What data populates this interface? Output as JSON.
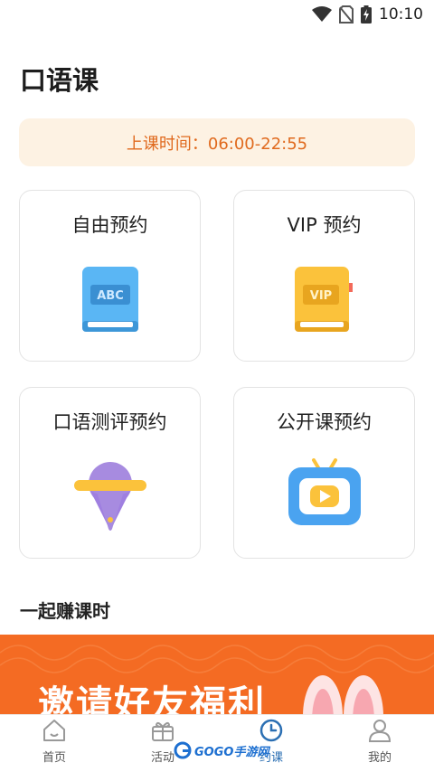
{
  "status_bar": {
    "time": "10:10"
  },
  "page": {
    "title": "口语课"
  },
  "schedule": {
    "text": "上课时间：06:00-22:55"
  },
  "cards": [
    {
      "label": "自由预约",
      "icon": "abc-book-icon"
    },
    {
      "label": "VIP 预约",
      "icon": "vip-book-icon"
    },
    {
      "label": "口语测评预约",
      "icon": "lollipop-microphone-icon"
    },
    {
      "label": "公开课预约",
      "icon": "tv-play-icon"
    }
  ],
  "icon_text": {
    "abc": "ABC",
    "vip": "VIP"
  },
  "section": {
    "title": "一起赚课时"
  },
  "banner": {
    "text": "邀请好友福利"
  },
  "tabs": [
    {
      "label": "首页",
      "icon": "home-icon"
    },
    {
      "label": "活动",
      "icon": "gift-icon"
    },
    {
      "label": "约课",
      "icon": "clock-icon",
      "active": true
    },
    {
      "label": "我的",
      "icon": "person-icon"
    }
  ],
  "watermark": {
    "text": "GOGO手游网"
  },
  "colors": {
    "accent": "#e06a1e",
    "banner": "#f46b23",
    "active_tab": "#2b6fb3",
    "schedule_bg": "#fdf2e3"
  }
}
